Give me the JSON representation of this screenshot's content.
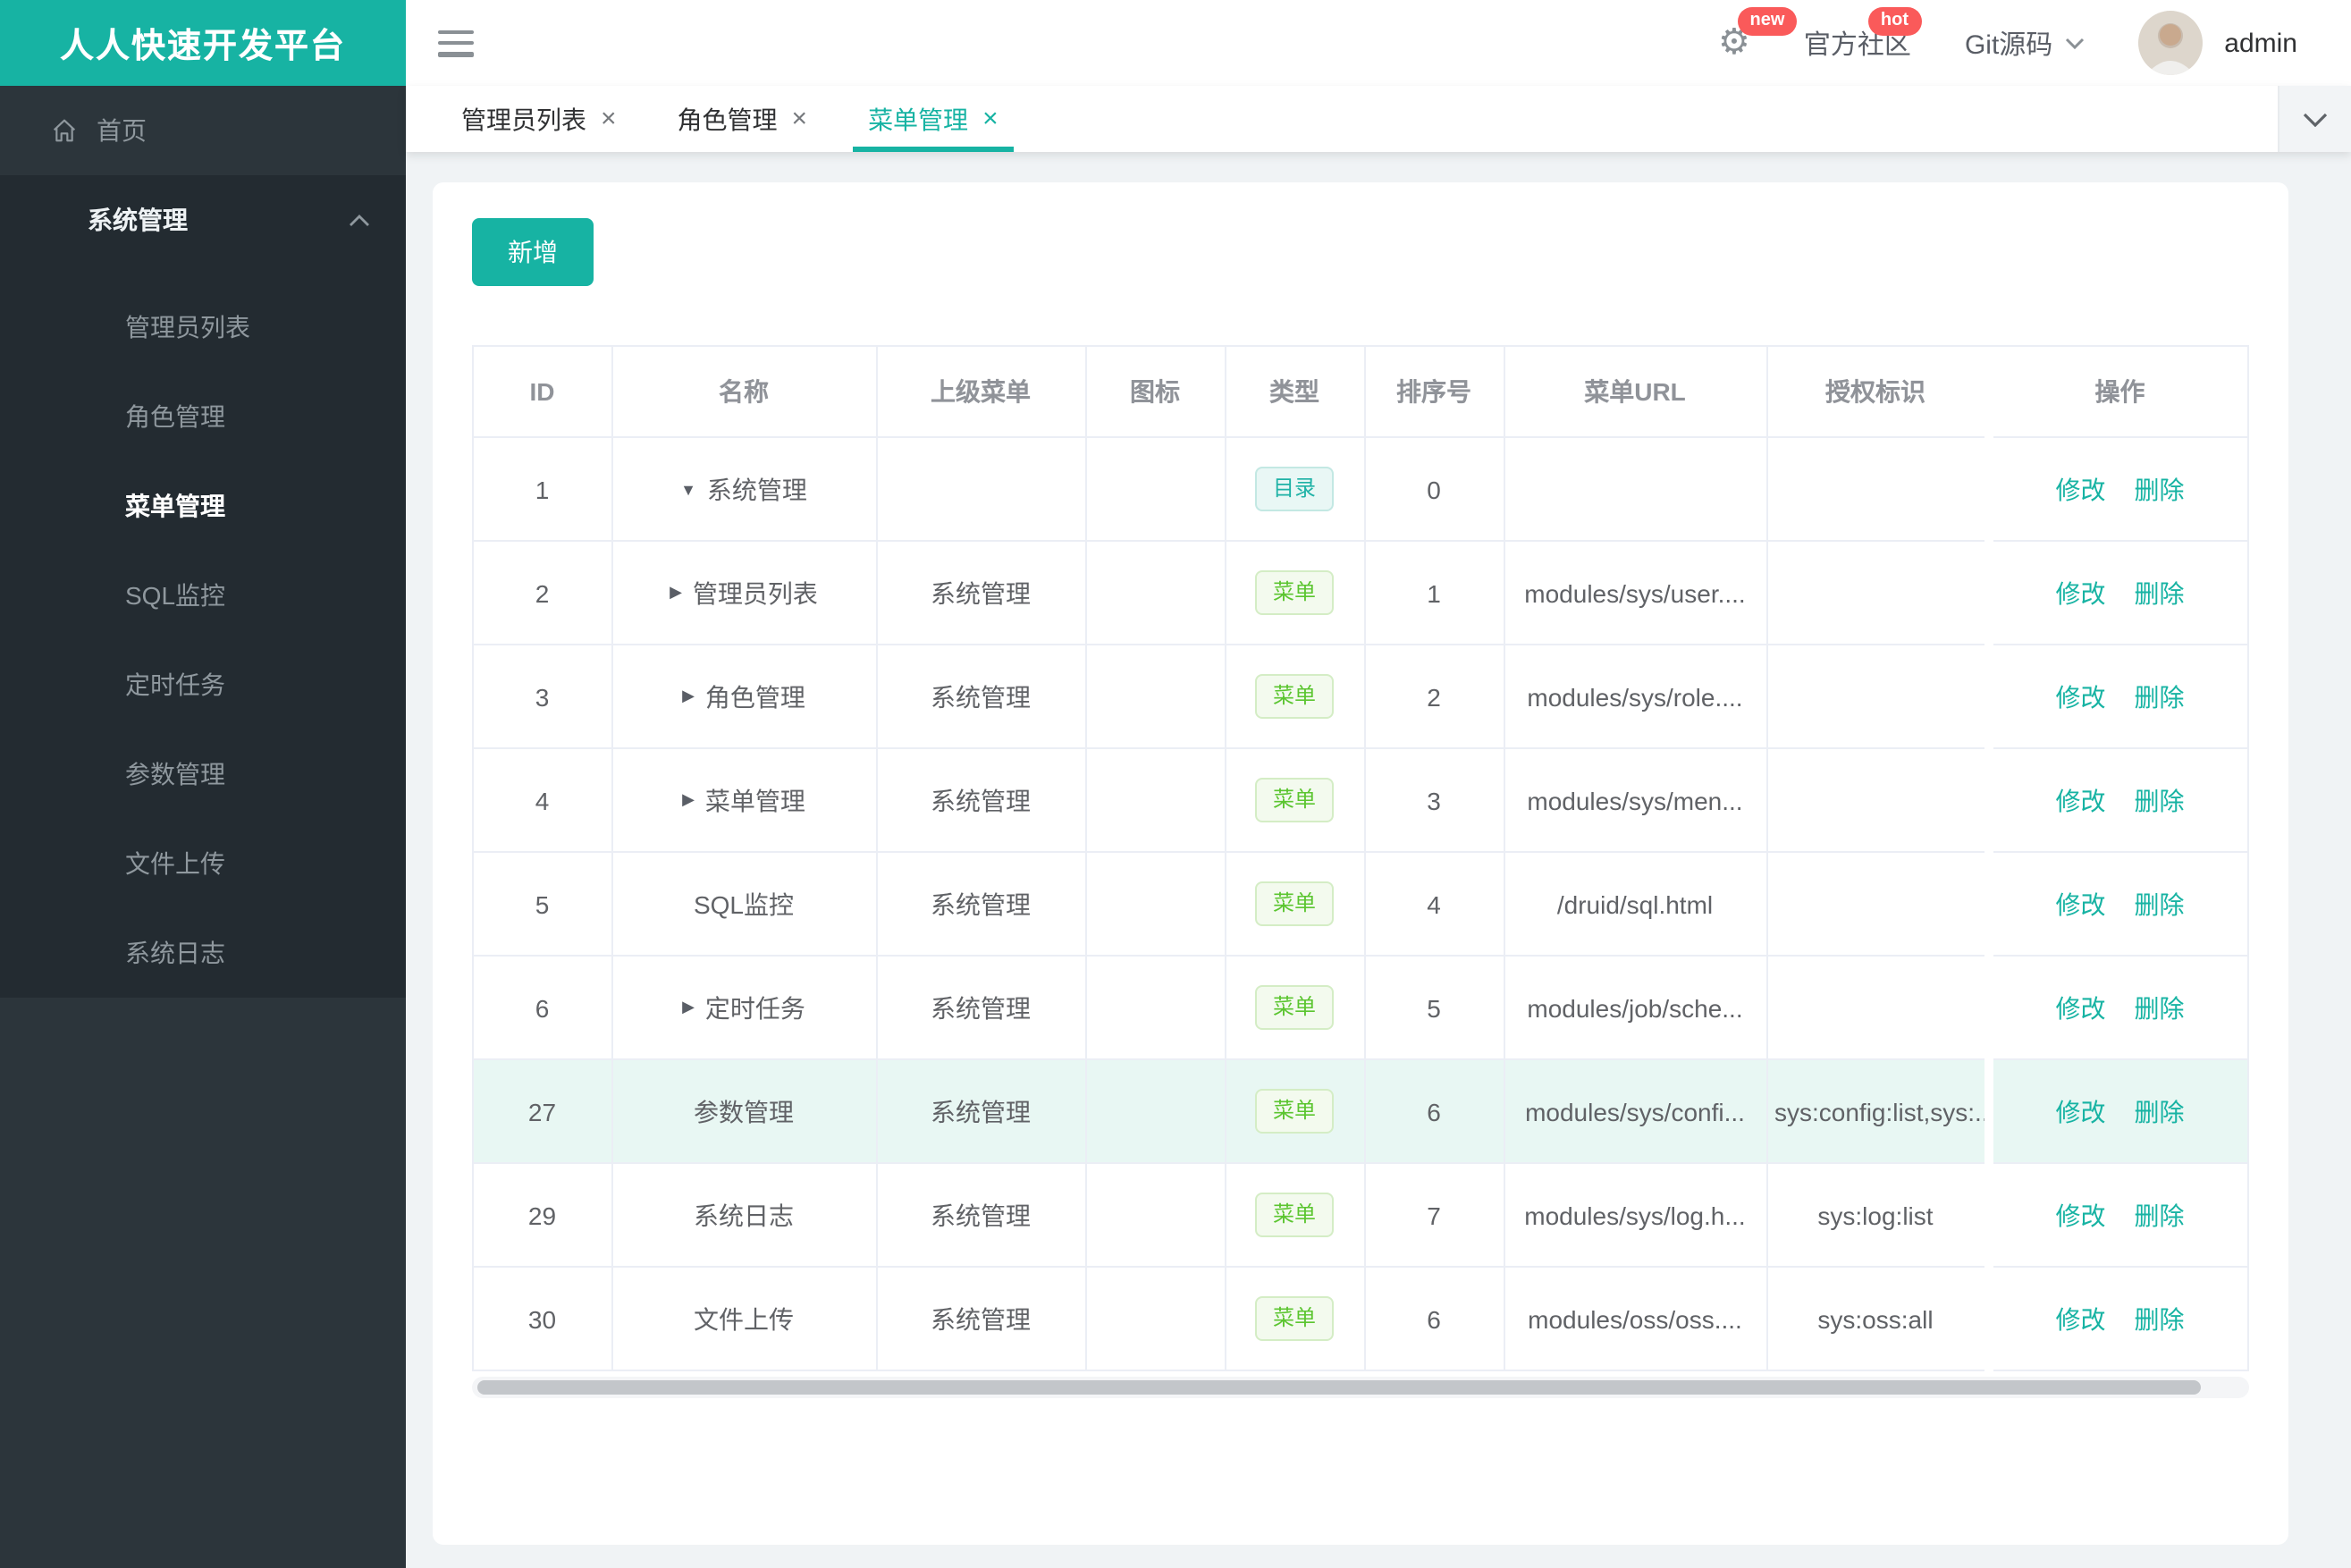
{
  "brand": {
    "title": "人人快速开发平台"
  },
  "header": {
    "settings_badge": "new",
    "community_label": "官方社区",
    "community_badge": "hot",
    "git_label": "Git源码",
    "username": "admin"
  },
  "sidebar": {
    "home_label": "首页",
    "group_label": "系统管理",
    "children": [
      {
        "label": "管理员列表",
        "active": false
      },
      {
        "label": "角色管理",
        "active": false
      },
      {
        "label": "菜单管理",
        "active": true
      },
      {
        "label": "SQL监控",
        "active": false
      },
      {
        "label": "定时任务",
        "active": false
      },
      {
        "label": "参数管理",
        "active": false
      },
      {
        "label": "文件上传",
        "active": false
      },
      {
        "label": "系统日志",
        "active": false
      }
    ]
  },
  "tabs": [
    {
      "label": "管理员列表",
      "active": false
    },
    {
      "label": "角色管理",
      "active": false
    },
    {
      "label": "菜单管理",
      "active": true
    }
  ],
  "toolbar": {
    "add_label": "新增"
  },
  "table": {
    "columns": [
      "ID",
      "名称",
      "上级菜单",
      "图标",
      "类型",
      "排序号",
      "菜单URL",
      "授权标识",
      "操作"
    ],
    "type_labels": {
      "dir": "目录",
      "menu": "菜单"
    },
    "actions": {
      "edit": "修改",
      "delete": "删除"
    },
    "rows": [
      {
        "id": "1",
        "arrow": "down",
        "name": "系统管理",
        "parent": "",
        "icon": "",
        "type": "dir",
        "order": "0",
        "url": "",
        "perm": "",
        "highlight": false
      },
      {
        "id": "2",
        "arrow": "right",
        "name": "管理员列表",
        "parent": "系统管理",
        "icon": "",
        "type": "menu",
        "order": "1",
        "url": "modules/sys/user....",
        "perm": "",
        "highlight": false
      },
      {
        "id": "3",
        "arrow": "right",
        "name": "角色管理",
        "parent": "系统管理",
        "icon": "",
        "type": "menu",
        "order": "2",
        "url": "modules/sys/role....",
        "perm": "",
        "highlight": false
      },
      {
        "id": "4",
        "arrow": "right",
        "name": "菜单管理",
        "parent": "系统管理",
        "icon": "",
        "type": "menu",
        "order": "3",
        "url": "modules/sys/men...",
        "perm": "",
        "highlight": false
      },
      {
        "id": "5",
        "arrow": "",
        "name": "SQL监控",
        "parent": "系统管理",
        "icon": "",
        "type": "menu",
        "order": "4",
        "url": "/druid/sql.html",
        "perm": "",
        "highlight": false
      },
      {
        "id": "6",
        "arrow": "right",
        "name": "定时任务",
        "parent": "系统管理",
        "icon": "",
        "type": "menu",
        "order": "5",
        "url": "modules/job/sche...",
        "perm": "",
        "highlight": false
      },
      {
        "id": "27",
        "arrow": "",
        "name": "参数管理",
        "parent": "系统管理",
        "icon": "",
        "type": "menu",
        "order": "6",
        "url": "modules/sys/confi...",
        "perm": "sys:config:list,sys:...",
        "highlight": true
      },
      {
        "id": "29",
        "arrow": "",
        "name": "系统日志",
        "parent": "系统管理",
        "icon": "",
        "type": "menu",
        "order": "7",
        "url": "modules/sys/log.h...",
        "perm": "sys:log:list",
        "highlight": false
      },
      {
        "id": "30",
        "arrow": "",
        "name": "文件上传",
        "parent": "系统管理",
        "icon": "",
        "type": "menu",
        "order": "6",
        "url": "modules/oss/oss....",
        "perm": "sys:oss:all",
        "highlight": false
      }
    ]
  },
  "icons": {
    "settings": "⚙",
    "close": "×",
    "arrow_down": "▼",
    "arrow_right": "▶"
  },
  "colors": {
    "accent": "#17b3a3",
    "badge_red": "#fa5a5a",
    "tag_dir_text": "#1fb2a6",
    "tag_menu_text": "#5bc530",
    "sidebar_bg": "#2c353b",
    "submenu_bg": "#232b31",
    "row_highlight": "#e8f7f3"
  }
}
